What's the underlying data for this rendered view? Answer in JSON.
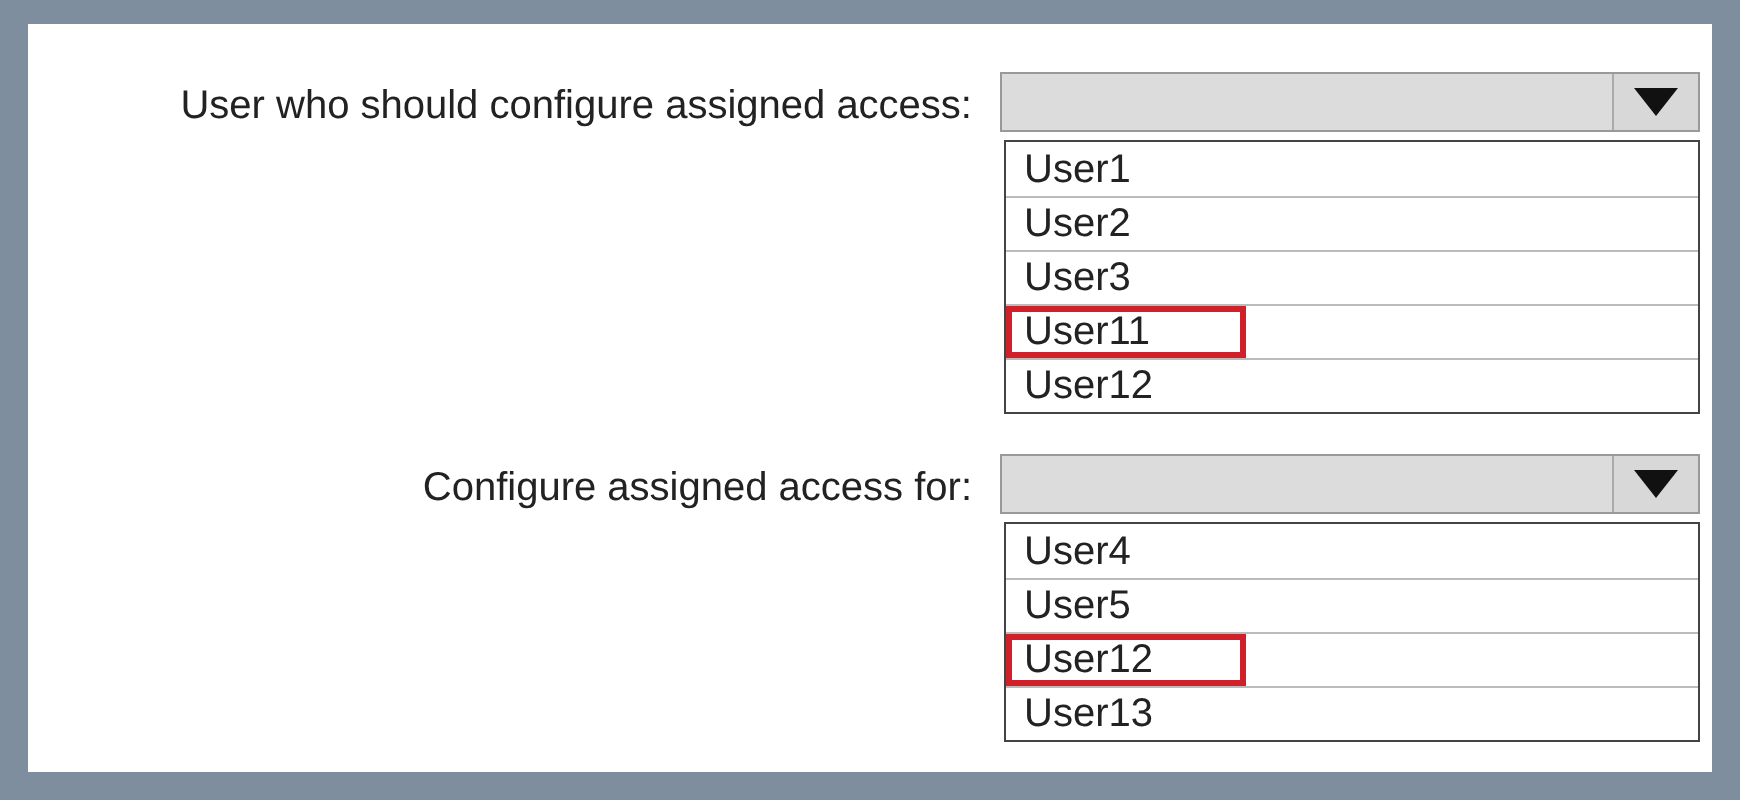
{
  "questions": [
    {
      "label": "User who should configure assigned access:",
      "options": [
        {
          "label": "User1",
          "selected": false
        },
        {
          "label": "User2",
          "selected": false
        },
        {
          "label": "User3",
          "selected": false
        },
        {
          "label": "User11",
          "selected": true
        },
        {
          "label": "User12",
          "selected": false
        }
      ]
    },
    {
      "label": "Configure assigned access for:",
      "options": [
        {
          "label": "User4",
          "selected": false
        },
        {
          "label": "User5",
          "selected": false
        },
        {
          "label": "User12",
          "selected": true
        },
        {
          "label": "User13",
          "selected": false
        }
      ]
    }
  ]
}
